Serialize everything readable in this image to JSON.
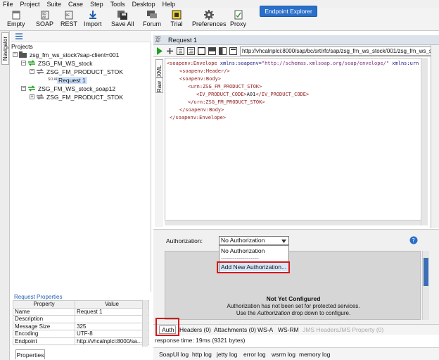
{
  "menu": [
    "File",
    "Project",
    "Suite",
    "Case",
    "Step",
    "Tools",
    "Desktop",
    "Help"
  ],
  "toolbar": {
    "buttons": [
      {
        "label": "Empty",
        "icon": "empty-project-icon"
      },
      {
        "label": "SOAP",
        "icon": "soap-icon"
      },
      {
        "label": "REST",
        "icon": "rest-icon"
      },
      {
        "label": "Import",
        "icon": "import-icon"
      },
      {
        "label": "Save All",
        "icon": "save-all-icon"
      },
      {
        "label": "Forum",
        "icon": "forum-icon"
      },
      {
        "label": "Trial",
        "icon": "trial-icon"
      },
      {
        "label": "Preferences",
        "icon": "gear-icon"
      },
      {
        "label": "Proxy",
        "icon": "proxy-icon"
      }
    ],
    "endpoint_explorer": "Endpoint Explorer"
  },
  "navigator": {
    "tab_label": "Navigator",
    "projects_label": "Projects"
  },
  "tree": {
    "project": "zsg_fm_ws_stock?sap-client=001",
    "binding1": "ZSG_FM_WS_stock",
    "operation1": "ZSG_FM_PRODUCT_STOK",
    "request": "Request 1",
    "request_icon_text": "SO AP",
    "binding2": "ZSG_FM_WS_stock_soap12",
    "operation2": "ZSG_FM_PRODUCT_STOK"
  },
  "request_properties": {
    "title": "Request Properties",
    "headers": [
      "Property",
      "Value"
    ],
    "rows": [
      [
        "Name",
        "Request 1"
      ],
      [
        "Description",
        ""
      ],
      [
        "Message Size",
        "325"
      ],
      [
        "Encoding",
        "UTF-8"
      ],
      [
        "Endpoint",
        "http://vhcalnplci:8000/sa..."
      ]
    ],
    "tab": "Properties"
  },
  "request_window": {
    "title": "Request 1",
    "icon_text": "SO AP",
    "url": "http://vhcalnplci:8000/sap/bc/srt/rfc/sap/zsg_fm_ws_stock/001/zsg_fm_ws_stock/zs",
    "side_tabs": [
      "XML",
      "Raw"
    ]
  },
  "xml": {
    "line1_tag": "<soapenv:Envelope",
    "line1_attr": " xmlns:soapenv=",
    "line1_val": "\"http://schemas.xmlsoap.org/soap/envelope/\"",
    "line1_attr2": " xmlns:urn",
    "line2": "<soapenv:Header/>",
    "line3": "<soapenv:Body>",
    "line4": "<urn:ZSG_FM_PRODUCT_STOK>",
    "line5_open": "<IV_PRODUCT_CODE>",
    "line5_text": "A01",
    "line5_close": "</IV_PRODUCT_CODE>",
    "line6": "</urn:ZSG_FM_PRODUCT_STOK>",
    "line7": "</soapenv:Body>",
    "line8": "</soapenv:Envelope>"
  },
  "auth": {
    "label": "Authorization:",
    "selected": "No Authorization",
    "options": [
      "No Authorization",
      "-------------------",
      "Add New Authorization..."
    ],
    "help_icon": "help-icon",
    "not_configured_title": "Not Yet Configured",
    "not_configured_line1": "Authorization has not been set for protected services.",
    "not_configured_line2_pre": "Use the ",
    "not_configured_line2_em": "Authorization",
    "not_configured_line2_post": " drop down to configure."
  },
  "bottom_tabs": {
    "auth": "Auth",
    "headers": "Headers (0)",
    "attachments": "Attachments (0)",
    "wsa": "WS-A",
    "wsrm": "WS-RM",
    "jms_headers": "JMS Headers",
    "jms_property": "JMS Property (0)"
  },
  "response_time": "response time: 19ms (9321 bytes)",
  "logs": [
    "SoapUI log",
    "http log",
    "jetty log",
    "error log",
    "wsrm log",
    "memory log"
  ],
  "colors": {
    "accent": "#2a6fc9",
    "highlight": "#d21a1a",
    "green_run": "#1fa01f"
  }
}
